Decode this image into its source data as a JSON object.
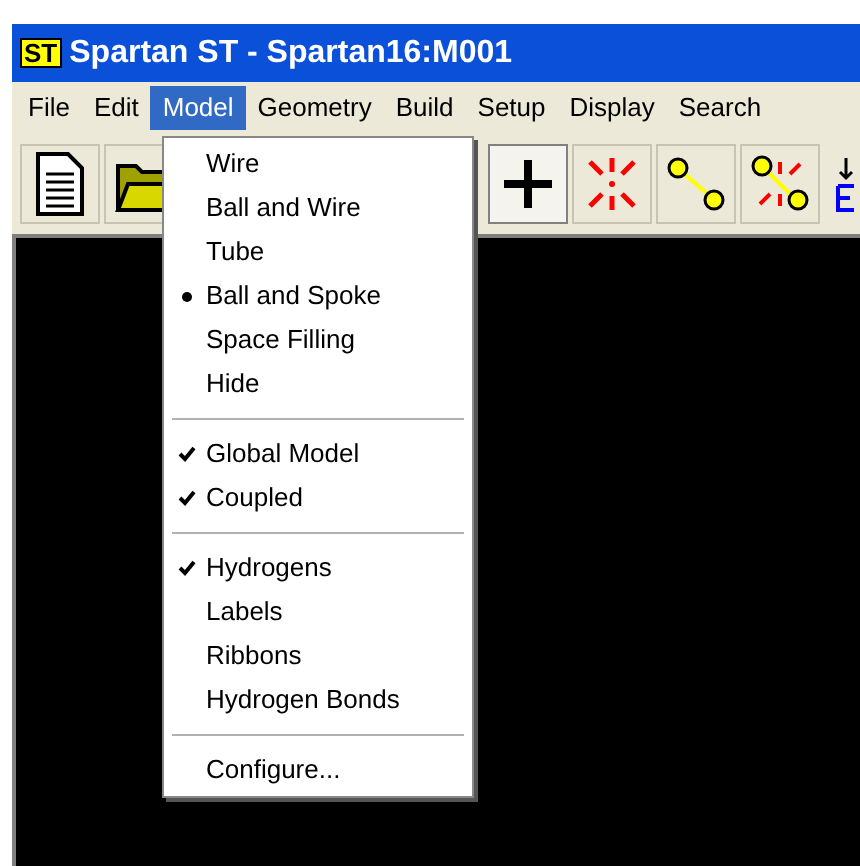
{
  "window": {
    "title": "Spartan ST - Spartan16:M001",
    "logo": "ST"
  },
  "menu_bar": [
    {
      "label": "File",
      "selected": false
    },
    {
      "label": "Edit",
      "selected": false
    },
    {
      "label": "Model",
      "selected": true
    },
    {
      "label": "Geometry",
      "selected": false
    },
    {
      "label": "Build",
      "selected": false
    },
    {
      "label": "Setup",
      "selected": false
    },
    {
      "label": "Display",
      "selected": false
    },
    {
      "label": "Search",
      "selected": false
    }
  ],
  "menu": {
    "groups": [
      [
        {
          "kind": "radio",
          "label": "Wire",
          "selected": false
        },
        {
          "kind": "radio",
          "label": "Ball and Wire",
          "selected": false
        },
        {
          "kind": "radio",
          "label": "Tube",
          "selected": false
        },
        {
          "kind": "radio",
          "label": "Ball and Spoke",
          "selected": true
        },
        {
          "kind": "radio",
          "label": "Space Filling",
          "selected": false
        },
        {
          "kind": "radio",
          "label": "Hide",
          "selected": false
        }
      ],
      [
        {
          "kind": "check",
          "label": "Global Model",
          "checked": true
        },
        {
          "kind": "check",
          "label": "Coupled",
          "checked": true
        }
      ],
      [
        {
          "kind": "check",
          "label": "Hydrogens",
          "checked": true
        },
        {
          "kind": "check",
          "label": "Labels",
          "checked": false
        },
        {
          "kind": "check",
          "label": "Ribbons",
          "checked": false
        },
        {
          "kind": "check",
          "label": "Hydrogen Bonds",
          "checked": false
        }
      ],
      [
        {
          "kind": "command",
          "label": "Configure..."
        }
      ]
    ]
  },
  "toolbar": [
    {
      "kind": "new"
    },
    {
      "kind": "open"
    },
    {
      "kind": "add",
      "selected": true
    },
    {
      "kind": "delete",
      "selected": false
    },
    {
      "kind": "bond",
      "selected": false
    },
    {
      "kind": "unbond",
      "selected": false
    }
  ]
}
